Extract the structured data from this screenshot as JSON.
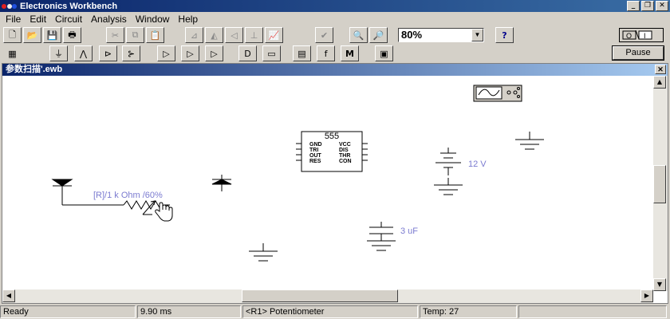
{
  "app": {
    "title": "Electronics Workbench"
  },
  "menu": [
    "File",
    "Edit",
    "Circuit",
    "Analysis",
    "Window",
    "Help"
  ],
  "toolbar": {
    "zoom_value": "80%",
    "help_label": "?",
    "pause_label": "Pause"
  },
  "document": {
    "title": "参数扫描'.ewb"
  },
  "circuit": {
    "ic_title": "555",
    "ic_pins_left": [
      "GND",
      "TRI",
      "OUT",
      "RES"
    ],
    "ic_pins_right": [
      "VCC",
      "DIS",
      "THR",
      "CON"
    ],
    "pot_label": "[R]/1 k Ohm /60%",
    "battery_label": "12 V",
    "cap_label": "3 uF"
  },
  "status": {
    "state": "Ready",
    "time": "9.90 ms",
    "component": "<R1> Potentiometer",
    "temp": "Temp: 27"
  },
  "colors": {
    "title_bar": "#0a246a",
    "component_label": "#7b7bd0",
    "face": "#d4d0c8"
  }
}
